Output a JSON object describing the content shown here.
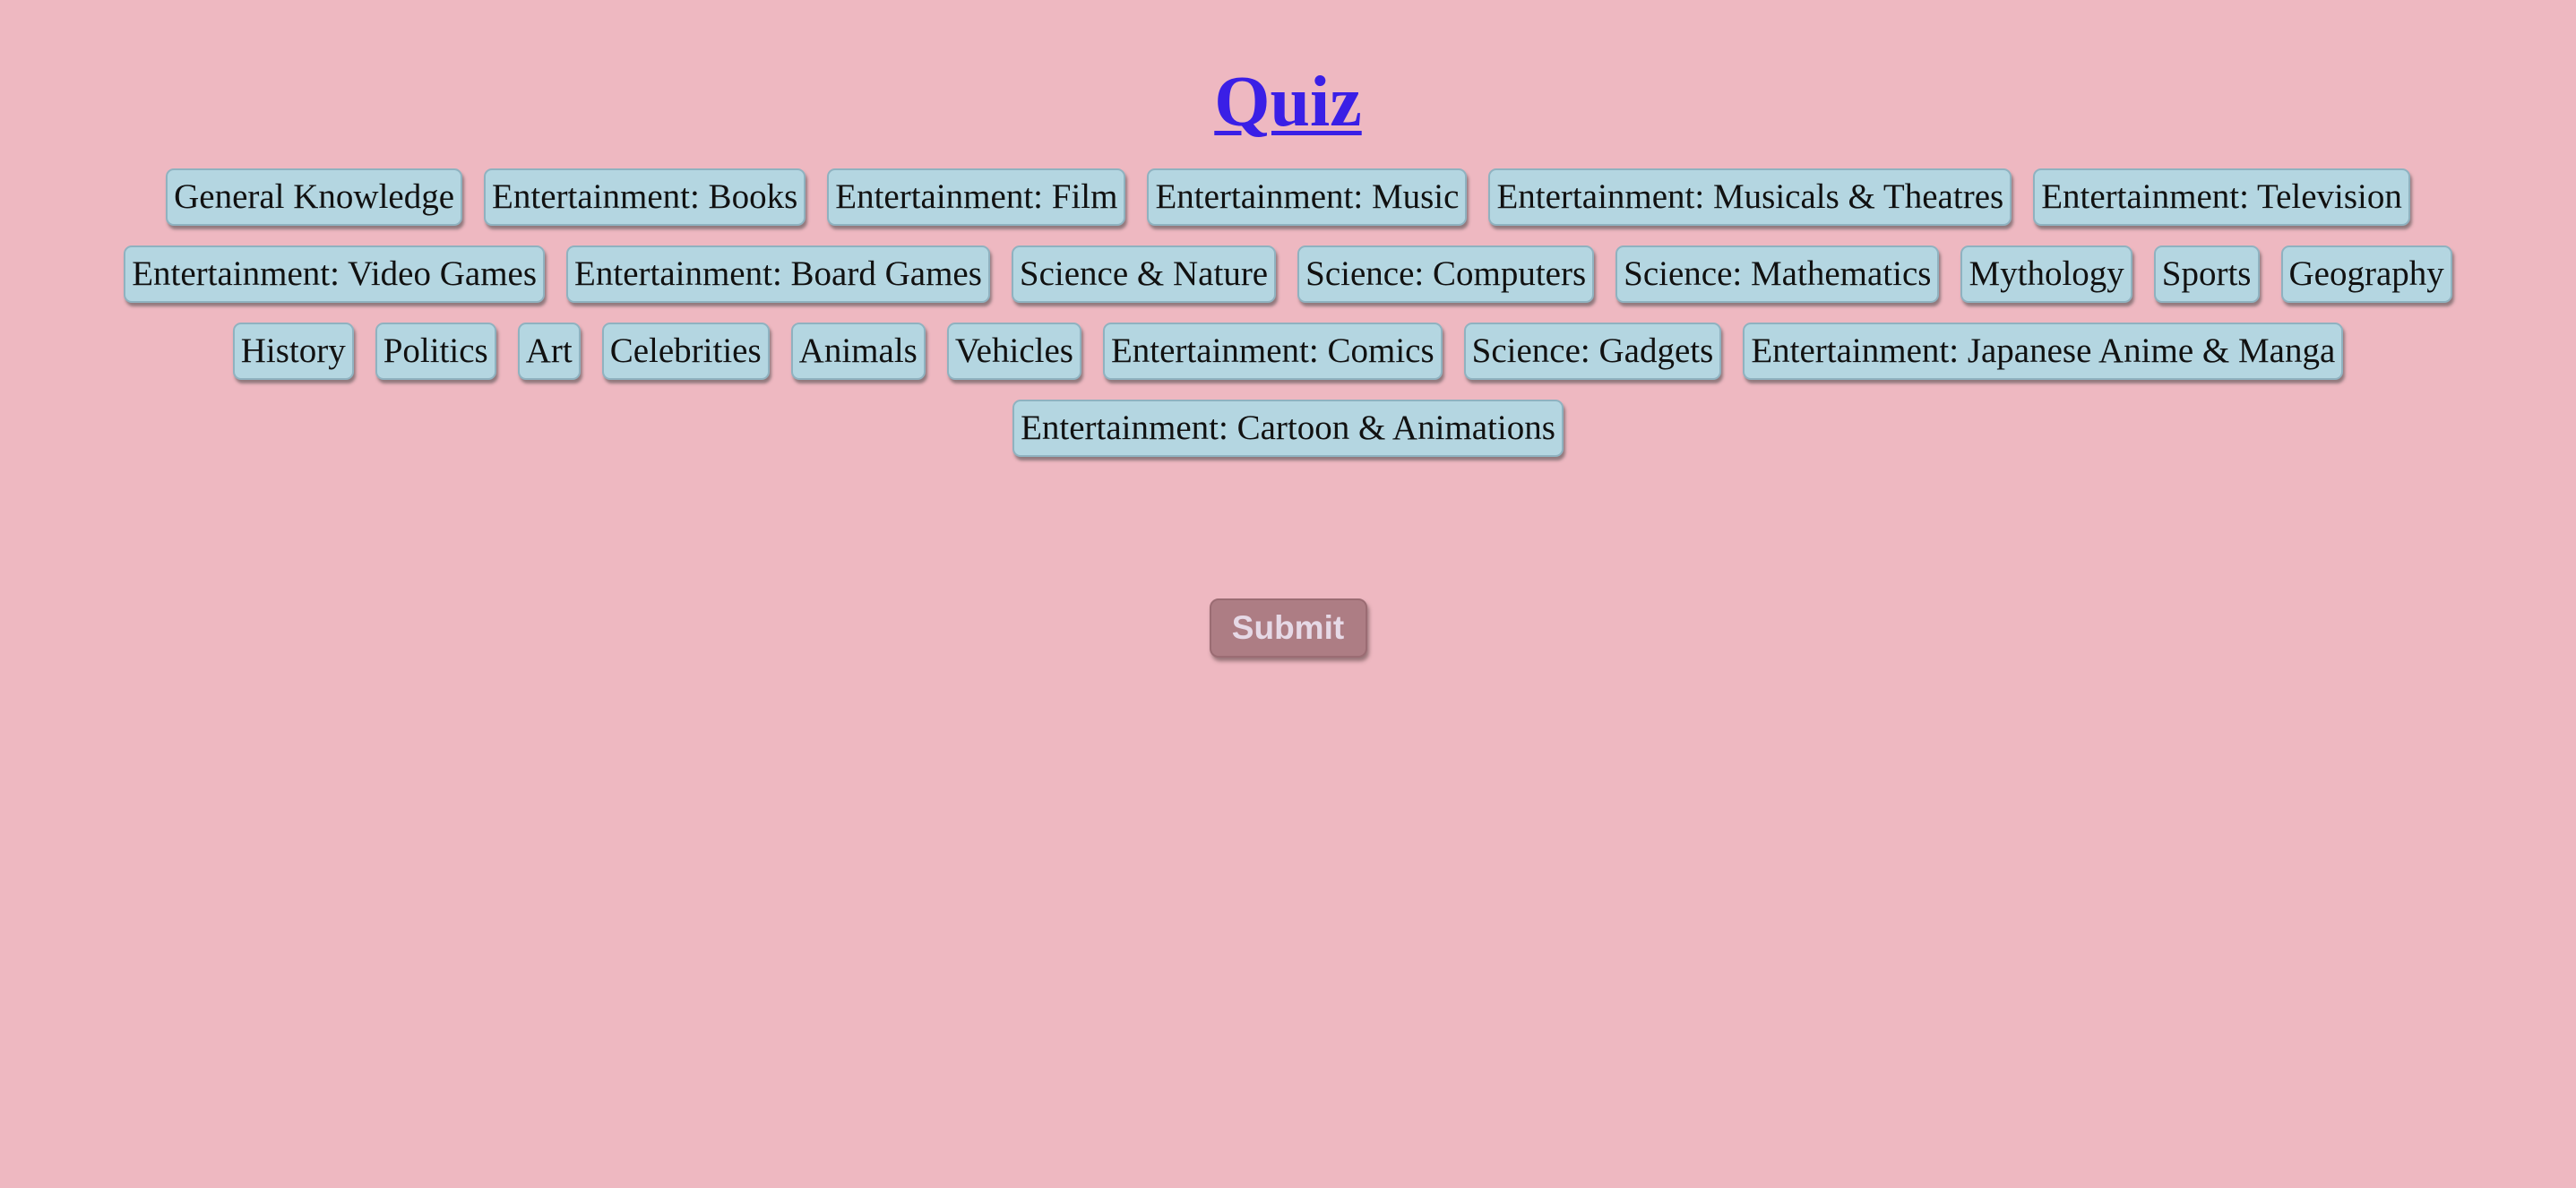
{
  "page": {
    "title": "Quiz",
    "background_color": "#eeb8c1",
    "title_color": "#3a1fe6"
  },
  "categories": [
    {
      "label": "General Knowledge"
    },
    {
      "label": "Entertainment: Books"
    },
    {
      "label": "Entertainment: Film"
    },
    {
      "label": "Entertainment: Music"
    },
    {
      "label": "Entertainment: Musicals & Theatres"
    },
    {
      "label": "Entertainment: Television"
    },
    {
      "label": "Entertainment: Video Games"
    },
    {
      "label": "Entertainment: Board Games"
    },
    {
      "label": "Science & Nature"
    },
    {
      "label": "Science: Computers"
    },
    {
      "label": "Science: Mathematics"
    },
    {
      "label": "Mythology"
    },
    {
      "label": "Sports"
    },
    {
      "label": "Geography"
    },
    {
      "label": "History"
    },
    {
      "label": "Politics"
    },
    {
      "label": "Art"
    },
    {
      "label": "Celebrities"
    },
    {
      "label": "Animals"
    },
    {
      "label": "Vehicles"
    },
    {
      "label": "Entertainment: Comics"
    },
    {
      "label": "Science: Gadgets"
    },
    {
      "label": "Entertainment: Japanese Anime & Manga"
    },
    {
      "label": "Entertainment: Cartoon & Animations"
    }
  ],
  "category_button_color": "#b4d6e1",
  "submit": {
    "label": "Submit",
    "color": "#ad7d84",
    "disabled": true
  }
}
